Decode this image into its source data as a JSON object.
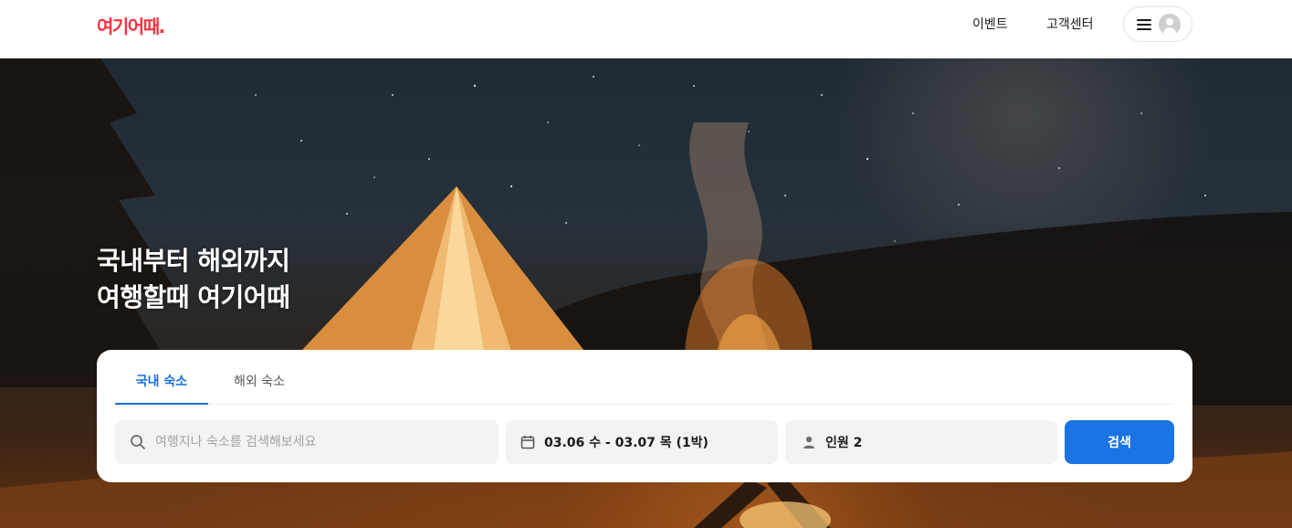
{
  "header": {
    "logo_text": "여기어때.",
    "nav": {
      "event": "이벤트",
      "support": "고객센터"
    },
    "menu_icon": "hamburger-icon",
    "avatar_icon": "user-avatar-icon"
  },
  "hero": {
    "title_line1": "국내부터 해외까지",
    "title_line2": "여행할때 여기어때"
  },
  "search": {
    "tabs": [
      {
        "label": "국내 숙소",
        "active": true
      },
      {
        "label": "해외 숙소",
        "active": false
      }
    ],
    "query_placeholder": "여행지나 숙소를 검색해보세요",
    "query_value": "",
    "dates": "03.06 수 - 03.07 목 (1박)",
    "guests": "인원 2",
    "submit_label": "검색"
  },
  "colors": {
    "brand": "#f7323f",
    "accent": "#1b74e4",
    "active_tab": "#1b6dd6"
  }
}
